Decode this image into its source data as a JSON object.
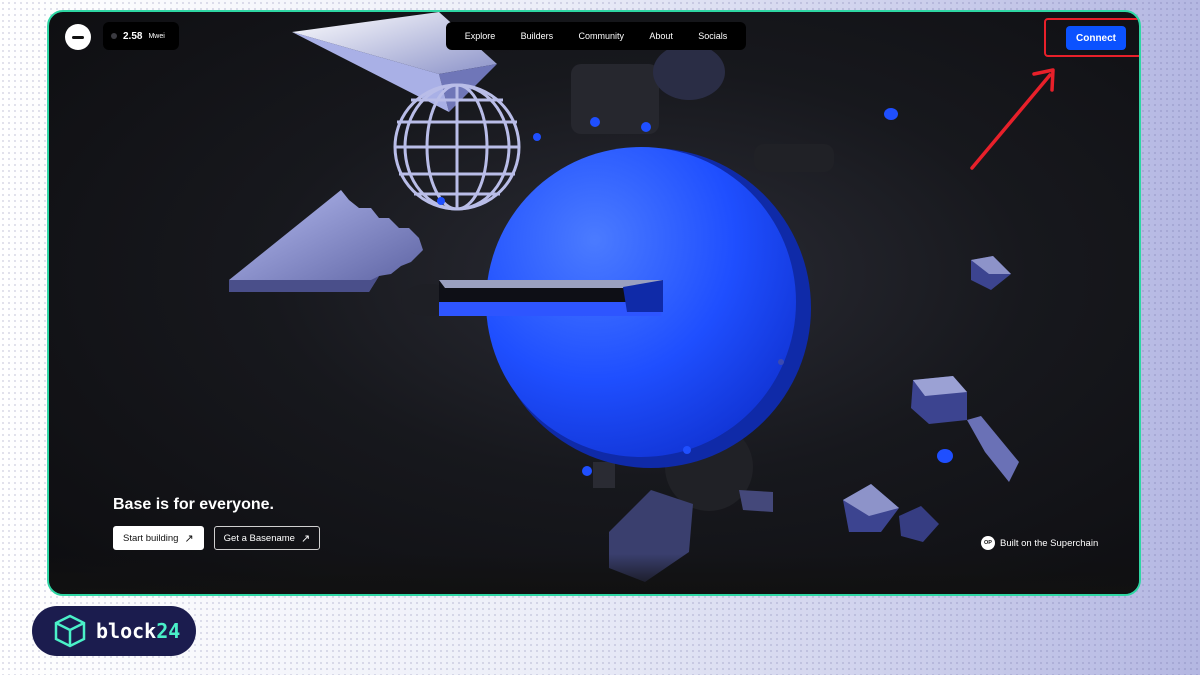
{
  "header": {
    "gas": {
      "value": "2.58",
      "unit": "Mwei"
    },
    "nav": [
      "Explore",
      "Builders",
      "Community",
      "About",
      "Socials"
    ],
    "connect_label": "Connect"
  },
  "hero": {
    "headline": "Base is for everyone.",
    "primary_button": "Start building",
    "secondary_button": "Get a Basename",
    "superchain_label": "Built on the Superchain",
    "op_badge": "OP"
  },
  "watermark": {
    "brand_prefix": "block",
    "brand_suffix": "24"
  },
  "colors": {
    "accent_blue": "#0b52ff",
    "frame_border": "#2ed6a3",
    "annotation_red": "#e8202a",
    "badge_bg": "#1b1c4e"
  },
  "icons": {
    "logo": "base-logo-icon",
    "arrow": "arrow-up-right-icon",
    "annotation": "red-arrow-annotation"
  }
}
